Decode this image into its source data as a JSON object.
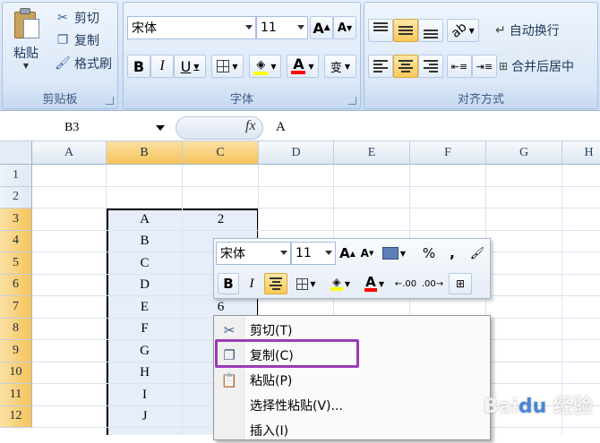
{
  "ribbon": {
    "clipboard": {
      "paste_label": "粘贴",
      "cut_label": "剪切",
      "copy_label": "复制",
      "format_painter_label": "格式刷",
      "group_label": "剪贴板"
    },
    "font": {
      "font_name": "宋体",
      "font_size": "11",
      "bold": "B",
      "italic": "I",
      "underline": "U",
      "font_color_glyph": "A",
      "phonetic_glyph": "变",
      "group_label": "字体"
    },
    "alignment": {
      "wrap_text_label": "自动换行",
      "merge_center_label": "合并后居中",
      "group_label": "对齐方式"
    }
  },
  "formula_bar": {
    "name_box": "B3",
    "fx": "fx",
    "value": "A"
  },
  "sheet": {
    "columns": [
      "A",
      "B",
      "C",
      "D",
      "E",
      "F",
      "G",
      "H"
    ],
    "rows": [
      "1",
      "2",
      "3",
      "4",
      "5",
      "6",
      "7",
      "8",
      "9",
      "10",
      "11",
      "12"
    ],
    "selected_column_labels": [
      "B",
      "C"
    ],
    "selected_row_labels": [
      "3",
      "4",
      "5",
      "6",
      "7",
      "8",
      "9",
      "10",
      "11",
      "12"
    ],
    "col_b_values": [
      "A",
      "B",
      "C",
      "D",
      "E",
      "F",
      "G",
      "H",
      "I",
      "J"
    ],
    "col_c_values": [
      "2",
      "6"
    ]
  },
  "mini_toolbar": {
    "font_name": "宋体",
    "font_size": "11",
    "percent": "%",
    "comma": ",",
    "bold": "B",
    "italic": "I",
    "font_color_glyph": "A"
  },
  "context_menu": {
    "items": [
      {
        "label": "剪切(T)",
        "icon": "scissors-icon"
      },
      {
        "label": "复制(C)",
        "icon": "copy-icon"
      },
      {
        "label": "粘贴(P)",
        "icon": "paste-icon"
      },
      {
        "label": "选择性粘贴(V)...",
        "icon": ""
      },
      {
        "label": "插入(I)",
        "icon": ""
      }
    ],
    "highlight_color": "#9b3cb6"
  },
  "watermark": "Baidu 经验"
}
